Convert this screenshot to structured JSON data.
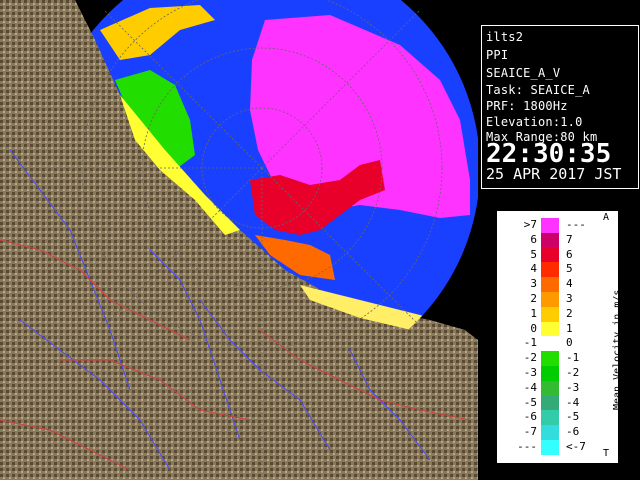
{
  "info": {
    "site": "ilts2",
    "product": "PPI",
    "product_name": "SEAICE_A_V",
    "task": "Task: SEAICE_A",
    "prf": "PRF: 1800Hz",
    "elevation": "Elevation:1.0",
    "max_range": "Max Range:80 km",
    "time": "22:30:35",
    "date": "25 APR 2017 JST"
  },
  "legend": {
    "title": "Mean Velocity in m/s",
    "top_marker": "A",
    "bottom_marker": "T",
    "rows": [
      {
        "left": ">7",
        "right": "---",
        "color": "#ff33ff"
      },
      {
        "left": "6",
        "right": "7",
        "color": "#cc0066"
      },
      {
        "left": "5",
        "right": "6",
        "color": "#e8002a"
      },
      {
        "left": "4",
        "right": "5",
        "color": "#ff2a00"
      },
      {
        "left": "3",
        "right": "4",
        "color": "#ff6a00"
      },
      {
        "left": "2",
        "right": "3",
        "color": "#ff9900"
      },
      {
        "left": "1",
        "right": "2",
        "color": "#ffcc00"
      },
      {
        "left": "0",
        "right": "1",
        "color": "#ffff33"
      },
      {
        "left": "-1",
        "right": "0",
        "color": "#ffffff"
      },
      {
        "left": "-2",
        "right": "-1",
        "color": "#22dd00"
      },
      {
        "left": "-3",
        "right": "-2",
        "color": "#00cc00"
      },
      {
        "left": "-4",
        "right": "-3",
        "color": "#33bb33"
      },
      {
        "left": "-5",
        "right": "-4",
        "color": "#33aa77"
      },
      {
        "left": "-6",
        "right": "-5",
        "color": "#33ccaa"
      },
      {
        "left": "-7",
        "right": "-6",
        "color": "#33dddd"
      },
      {
        "left": "---",
        "right": "<-7",
        "color": "#33ffff"
      }
    ]
  },
  "colors": {
    "ocean": "#1a40ff",
    "land": "#8a7a5c",
    "river": "#4a4aff",
    "boundary": "#d04040"
  }
}
